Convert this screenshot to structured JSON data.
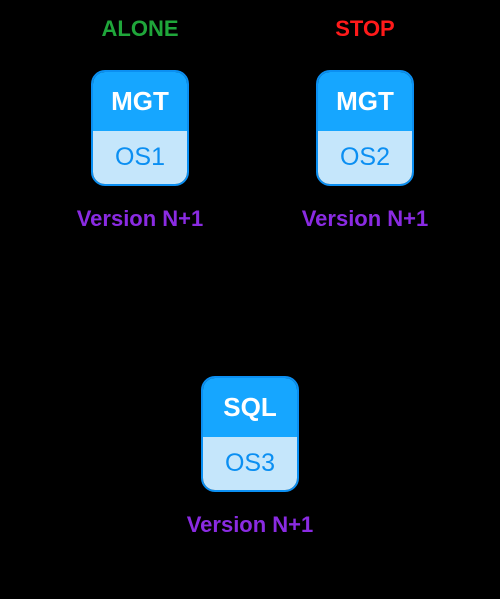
{
  "nodes": [
    {
      "id": "n1",
      "status": "ALONE",
      "status_style": "green",
      "service": "MGT",
      "os": "OS1",
      "version": "Version N+1"
    },
    {
      "id": "n2",
      "status": "STOP",
      "status_style": "red",
      "service": "MGT",
      "os": "OS2",
      "version": "Version N+1"
    },
    {
      "id": "n3",
      "status": "",
      "status_style": "none",
      "service": "SQL",
      "os": "OS3",
      "version": "Version N+1"
    }
  ]
}
